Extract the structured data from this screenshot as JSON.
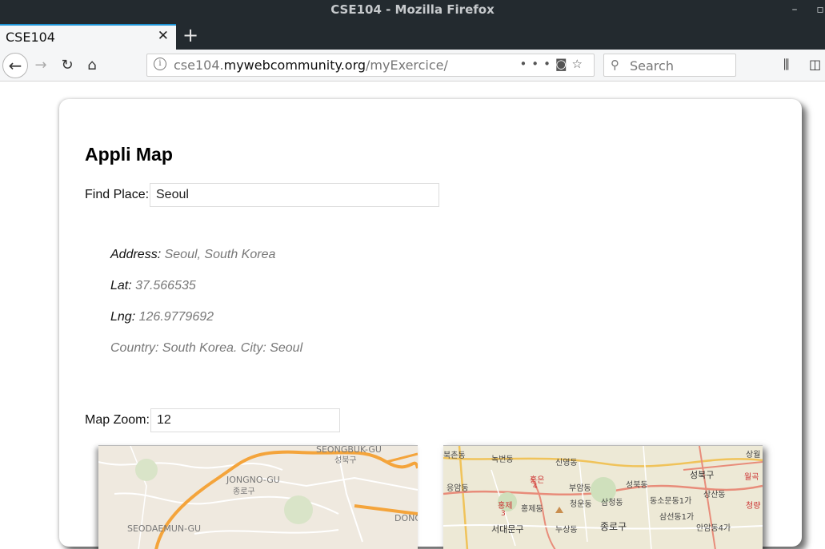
{
  "browser": {
    "window_title": "CSE104 - Mozilla Firefox",
    "tab_title": "CSE104",
    "url_prefix": "cse104.",
    "url_domain": "mywebcommunity.org",
    "url_path": "/myExercice/",
    "search_placeholder": "Search"
  },
  "page": {
    "title": "Appli Map",
    "find_label": "Find Place:",
    "find_value": "Seoul",
    "address_key": "Address:",
    "address_val": "Seoul, South Korea",
    "lat_key": "Lat:",
    "lat_val": "37.566535",
    "lng_key": "Lng:",
    "lng_val": "126.9779692",
    "country_line": "Country: South Korea. City: Seoul",
    "zoom_label": "Map Zoom:",
    "zoom_value": "12"
  },
  "map_left": {
    "labels": [
      "SEONGBUK-GU",
      "성북구",
      "JONGNO-GU",
      "종로구",
      "DONG",
      "SEODAEMUN-GU"
    ]
  },
  "map_right": {
    "labels": [
      "북촌동",
      "녹번동",
      "신영동",
      "상월",
      "응암동",
      "홍은",
      "부암동",
      "성북동",
      "성북구",
      "월곡",
      "홍제",
      "홍제동",
      "청운동",
      "삼청동",
      "동소문동1가",
      "청량",
      "상산동",
      "삼선동1가",
      "안암동4가",
      "서대문구",
      "종로구",
      "누상동",
      "4",
      "3"
    ]
  },
  "colors": {
    "chrome_dark": "#232a2f",
    "tab_accent": "#1d94d6",
    "road_orange": "#f4a43b"
  }
}
